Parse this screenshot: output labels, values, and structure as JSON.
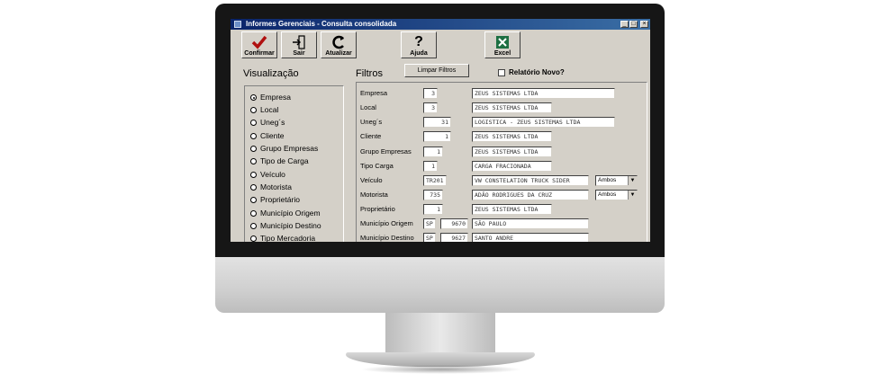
{
  "window": {
    "title": "Informes Gerenciais - Consulta consolidada"
  },
  "toolbar": {
    "confirmar": "Confirmar",
    "sair": "Sair",
    "atualizar": "Atualizar",
    "ajuda": "Ajuda",
    "excel": "Excel"
  },
  "visualizacao": {
    "title": "Visualização",
    "selected": "Empresa",
    "items": [
      "Empresa",
      "Local",
      "Uneg´s",
      "Cliente",
      "Grupo Empresas",
      "Tipo de Carga",
      "Veículo",
      "Motorista",
      "Proprietário",
      "Município Origem",
      "Município Destino",
      "Tipo Mercadoria"
    ]
  },
  "filtros": {
    "title": "Filtros",
    "limpar": "Limpar Filtros",
    "relatorio_novo": "Relatório Novo?",
    "relatorio_novo_checked": false,
    "rows": [
      {
        "label": "Empresa",
        "code": "3",
        "desc": "ZEUS SISTEMAS LTDA"
      },
      {
        "label": "Local",
        "code": "3",
        "desc": "ZEUS SISTEMAS LTDA"
      },
      {
        "label": "Uneg´s",
        "code": "31",
        "desc": "LOGISTICA - ZEUS SISTEMAS LTDA"
      },
      {
        "label": "Cliente",
        "code": "1",
        "desc": "ZEUS SISTEMAS LTDA"
      },
      {
        "label": "Grupo Empresas",
        "code": "1",
        "desc": "ZEUS SISTEMAS LTDA"
      },
      {
        "label": "Tipo Carga",
        "code": "1",
        "desc": "CARGA FRACIONADA"
      },
      {
        "label": "Veículo",
        "code": "TR201",
        "desc": "VW CONSTELATION TRUCK SIDER",
        "select": "Ambos"
      },
      {
        "label": "Motorista",
        "code": "735",
        "desc": "ADÃO RODRIGUES DA CRUZ",
        "select": "Ambos"
      },
      {
        "label": "Proprietário",
        "code": "1",
        "desc": "ZEUS SISTEMAS LTDA"
      },
      {
        "label": "Município Origem",
        "uf": "SP",
        "code": "9670",
        "desc": "SÃO PAULO"
      },
      {
        "label": "Município Destino",
        "uf": "SP",
        "code": "9627",
        "desc": "SANTO ANDRE"
      }
    ]
  },
  "colors": {
    "titlebar_start": "#0a246a",
    "titlebar_end": "#3a6ea5",
    "window_bg": "#d4d0c8",
    "excel_green": "#1d6f42",
    "confirm_red": "#b01010"
  }
}
